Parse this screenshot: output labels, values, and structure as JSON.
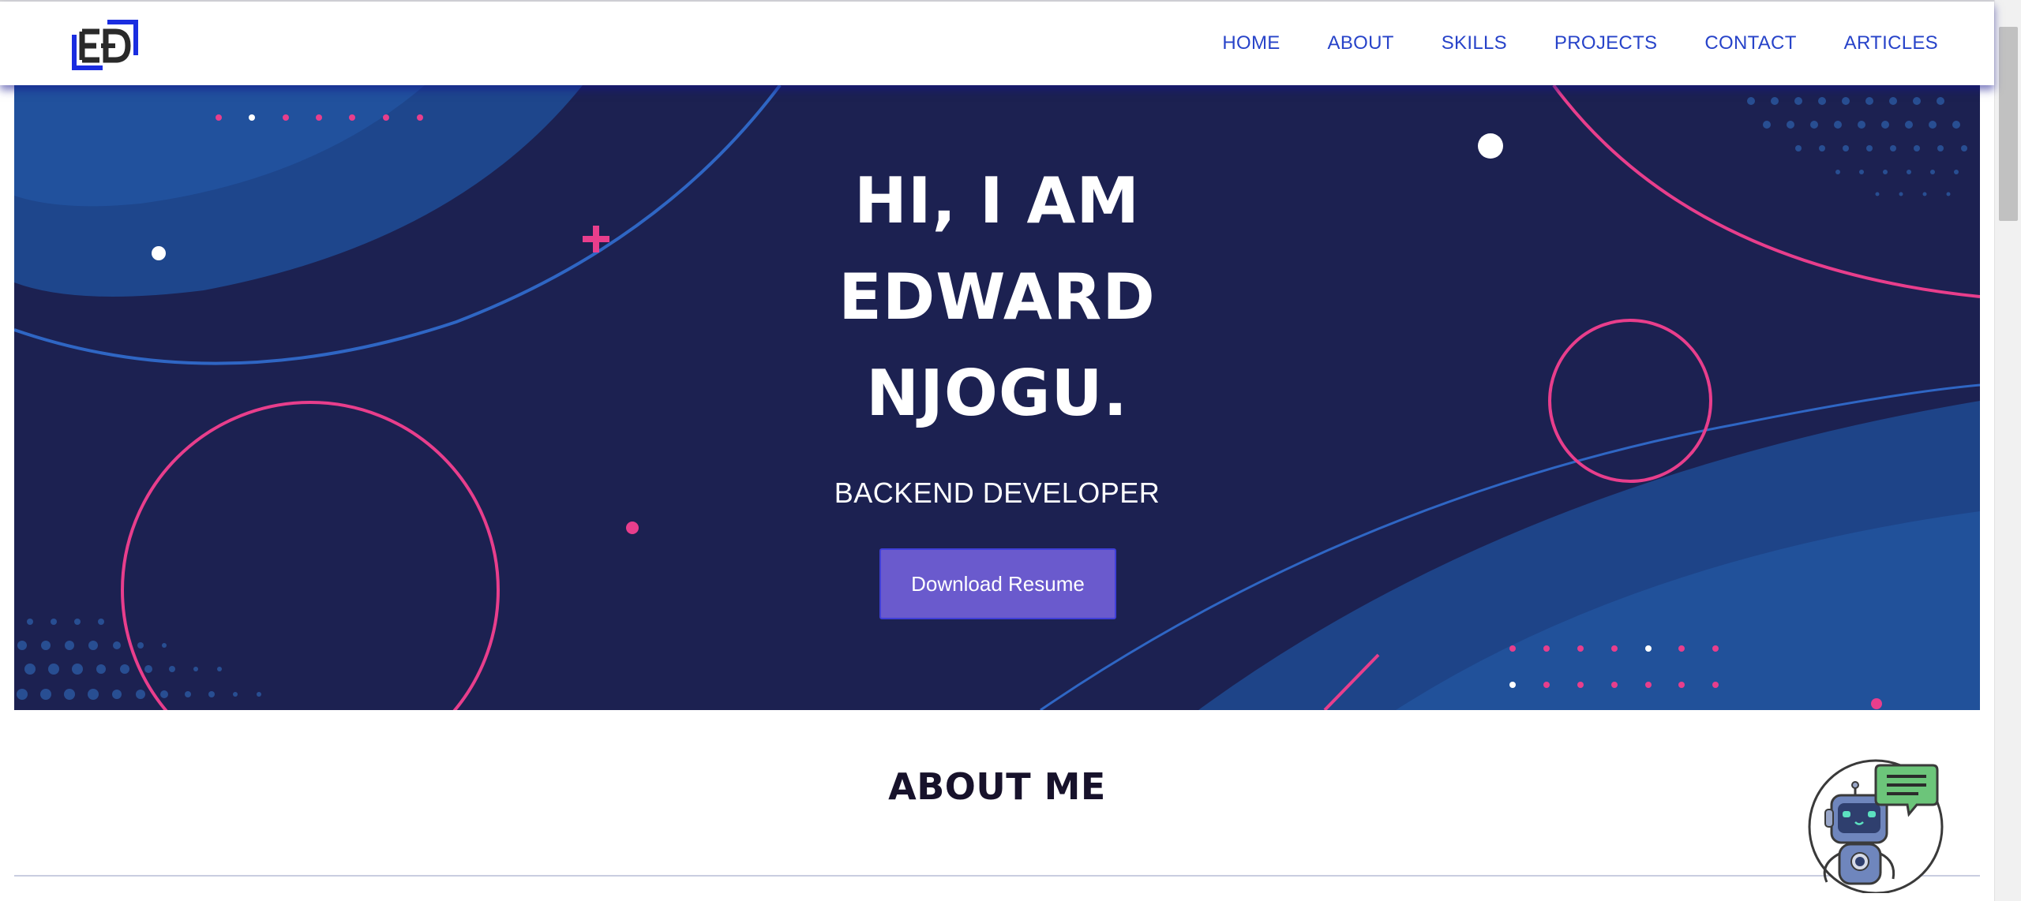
{
  "brand": {
    "logo_text": "ED"
  },
  "nav": {
    "links": [
      "HOME",
      "ABOUT",
      "SKILLS",
      "PROJECTS",
      "CONTACT",
      "ARTICLES"
    ]
  },
  "hero": {
    "line1": "HI, I AM",
    "line2": "EDWARD",
    "line3": "NJOGU.",
    "subtitle": "BACKEND DEVELOPER",
    "button_label": "Download Resume"
  },
  "about": {
    "title": "ABOUT ME"
  },
  "colors": {
    "nav_link": "#2743c9",
    "hero_bg": "#1c2151",
    "accent_pink": "#e83e8c",
    "button_bg": "#6a5acd",
    "heading_dark": "#17122b"
  },
  "icons": {
    "logo": "ed-monogram-logo",
    "chatbot": "robot-chat-icon"
  }
}
